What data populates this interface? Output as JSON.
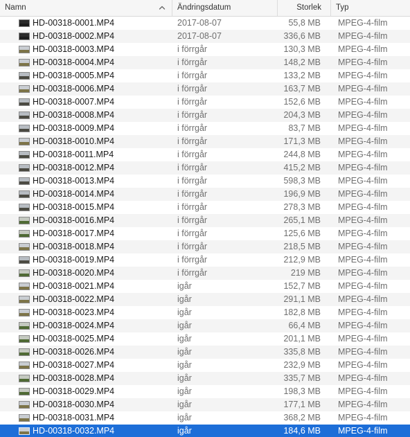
{
  "header": {
    "name_label": "Namn",
    "date_label": "Ändringsdatum",
    "size_label": "Storlek",
    "kind_label": "Typ",
    "sort_icon": "chevron-up-icon"
  },
  "colors": {
    "selection": "#1d6ed8",
    "stripe": "#f4f4f4",
    "secondary_text": "#6f6f6f"
  },
  "files": [
    {
      "name": "HD-00318-0001.MP4",
      "date": "2017-08-07",
      "size": "55,8 MB",
      "kind": "MPEG-4-film",
      "thumb": "dark"
    },
    {
      "name": "HD-00318-0002.MP4",
      "date": "2017-08-07",
      "size": "336,6 MB",
      "kind": "MPEG-4-film",
      "thumb": "dark"
    },
    {
      "name": "HD-00318-0003.MP4",
      "date": "i förrgår",
      "size": "130,3 MB",
      "kind": "MPEG-4-film",
      "thumb": "field"
    },
    {
      "name": "HD-00318-0004.MP4",
      "date": "i förrgår",
      "size": "148,2 MB",
      "kind": "MPEG-4-film",
      "thumb": "field"
    },
    {
      "name": "HD-00318-0005.MP4",
      "date": "i förrgår",
      "size": "133,2 MB",
      "kind": "MPEG-4-film",
      "thumb": "road"
    },
    {
      "name": "HD-00318-0006.MP4",
      "date": "i förrgår",
      "size": "163,7 MB",
      "kind": "MPEG-4-film",
      "thumb": "field"
    },
    {
      "name": "HD-00318-0007.MP4",
      "date": "i förrgår",
      "size": "152,6 MB",
      "kind": "MPEG-4-film",
      "thumb": "road"
    },
    {
      "name": "HD-00318-0008.MP4",
      "date": "i förrgår",
      "size": "204,3 MB",
      "kind": "MPEG-4-film",
      "thumb": "road"
    },
    {
      "name": "HD-00318-0009.MP4",
      "date": "i förrgår",
      "size": "83,7 MB",
      "kind": "MPEG-4-film",
      "thumb": "road"
    },
    {
      "name": "HD-00318-0010.MP4",
      "date": "i förrgår",
      "size": "171,3 MB",
      "kind": "MPEG-4-film",
      "thumb": "field"
    },
    {
      "name": "HD-00318-0011.MP4",
      "date": "i förrgår",
      "size": "244,8 MB",
      "kind": "MPEG-4-film",
      "thumb": "road"
    },
    {
      "name": "HD-00318-0012.MP4",
      "date": "i förrgår",
      "size": "415,2 MB",
      "kind": "MPEG-4-film",
      "thumb": "road"
    },
    {
      "name": "HD-00318-0013.MP4",
      "date": "i förrgår",
      "size": "598,3 MB",
      "kind": "MPEG-4-film",
      "thumb": "road"
    },
    {
      "name": "HD-00318-0014.MP4",
      "date": "i förrgår",
      "size": "196,9 MB",
      "kind": "MPEG-4-film",
      "thumb": "road"
    },
    {
      "name": "HD-00318-0015.MP4",
      "date": "i förrgår",
      "size": "278,3 MB",
      "kind": "MPEG-4-film",
      "thumb": "road"
    },
    {
      "name": "HD-00318-0016.MP4",
      "date": "i förrgår",
      "size": "265,1 MB",
      "kind": "MPEG-4-film",
      "thumb": "green"
    },
    {
      "name": "HD-00318-0017.MP4",
      "date": "i förrgår",
      "size": "125,6 MB",
      "kind": "MPEG-4-film",
      "thumb": "green"
    },
    {
      "name": "HD-00318-0018.MP4",
      "date": "i förrgår",
      "size": "218,5 MB",
      "kind": "MPEG-4-film",
      "thumb": "field"
    },
    {
      "name": "HD-00318-0019.MP4",
      "date": "i förrgår",
      "size": "212,9 MB",
      "kind": "MPEG-4-film",
      "thumb": "road"
    },
    {
      "name": "HD-00318-0020.MP4",
      "date": "i förrgår",
      "size": "219 MB",
      "kind": "MPEG-4-film",
      "thumb": "green"
    },
    {
      "name": "HD-00318-0021.MP4",
      "date": "igår",
      "size": "152,7 MB",
      "kind": "MPEG-4-film",
      "thumb": "field"
    },
    {
      "name": "HD-00318-0022.MP4",
      "date": "igår",
      "size": "291,1 MB",
      "kind": "MPEG-4-film",
      "thumb": "field"
    },
    {
      "name": "HD-00318-0023.MP4",
      "date": "igår",
      "size": "182,8 MB",
      "kind": "MPEG-4-film",
      "thumb": "field"
    },
    {
      "name": "HD-00318-0024.MP4",
      "date": "igår",
      "size": "66,4 MB",
      "kind": "MPEG-4-film",
      "thumb": "green"
    },
    {
      "name": "HD-00318-0025.MP4",
      "date": "igår",
      "size": "201,1 MB",
      "kind": "MPEG-4-film",
      "thumb": "green"
    },
    {
      "name": "HD-00318-0026.MP4",
      "date": "igår",
      "size": "335,8 MB",
      "kind": "MPEG-4-film",
      "thumb": "green"
    },
    {
      "name": "HD-00318-0027.MP4",
      "date": "igår",
      "size": "232,9 MB",
      "kind": "MPEG-4-film",
      "thumb": "field"
    },
    {
      "name": "HD-00318-0028.MP4",
      "date": "igår",
      "size": "335,7 MB",
      "kind": "MPEG-4-film",
      "thumb": "green"
    },
    {
      "name": "HD-00318-0029.MP4",
      "date": "igår",
      "size": "198,3 MB",
      "kind": "MPEG-4-film",
      "thumb": "green"
    },
    {
      "name": "HD-00318-0030.MP4",
      "date": "igår",
      "size": "177,1 MB",
      "kind": "MPEG-4-film",
      "thumb": "field"
    },
    {
      "name": "HD-00318-0031.MP4",
      "date": "igår",
      "size": "368,2 MB",
      "kind": "MPEG-4-film",
      "thumb": "field"
    },
    {
      "name": "HD-00318-0032.MP4",
      "date": "igår",
      "size": "184,6 MB",
      "kind": "MPEG-4-film",
      "thumb": "field",
      "selected": true
    }
  ]
}
